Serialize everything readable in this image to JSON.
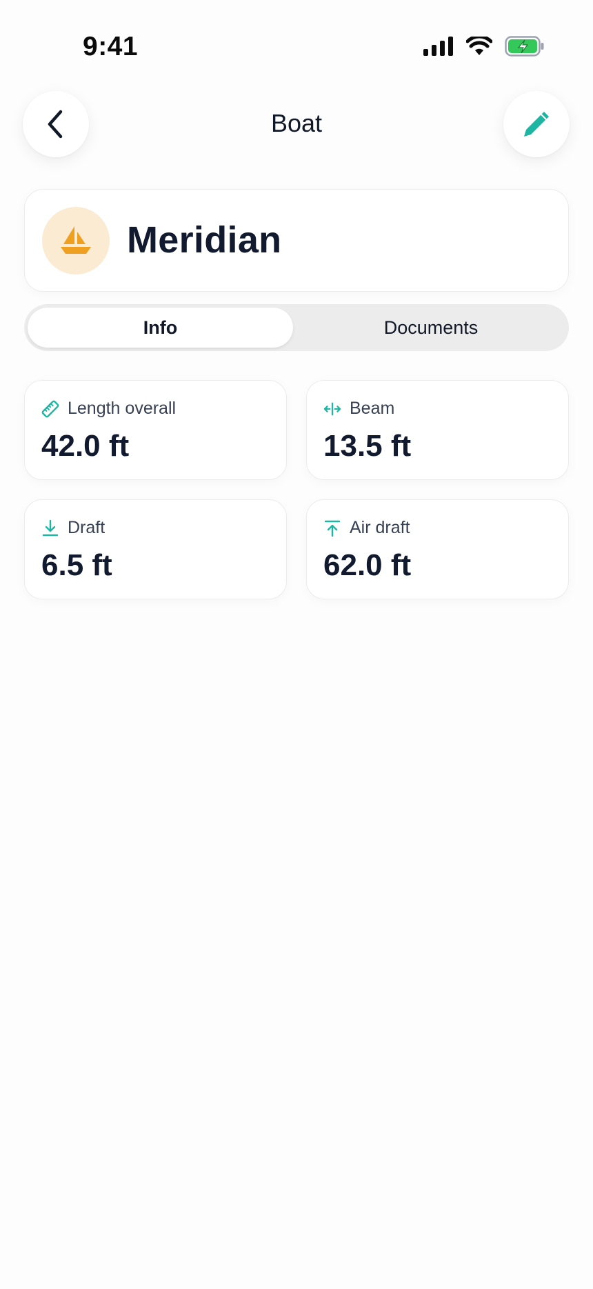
{
  "status_bar": {
    "time": "9:41",
    "icons": [
      "signal-icon",
      "wifi-icon",
      "battery-charging-icon"
    ]
  },
  "header": {
    "title": "Boat",
    "back_icon": "chevron-left-icon",
    "edit_icon": "pencil-icon"
  },
  "boat": {
    "name": "Meridian",
    "icon": "sailboat-icon"
  },
  "tabs": [
    {
      "label": "Info",
      "selected": true
    },
    {
      "label": "Documents",
      "selected": false
    }
  ],
  "stats": [
    {
      "label": "Length overall",
      "value": "42.0 ft",
      "icon": "ruler-icon"
    },
    {
      "label": "Beam",
      "value": "13.5 ft",
      "icon": "width-arrows-icon"
    },
    {
      "label": "Draft",
      "value": "6.5 ft",
      "icon": "arrow-down-to-line-icon"
    },
    {
      "label": "Air draft",
      "value": "62.0 ft",
      "icon": "arrow-up-from-line-icon"
    }
  ],
  "colors": {
    "accent": "#1fb5a3",
    "boat_icon": "#f0a020",
    "boat_avatar_bg": "#fcebd3",
    "text_primary": "#111a2e",
    "battery_green": "#34c759"
  }
}
